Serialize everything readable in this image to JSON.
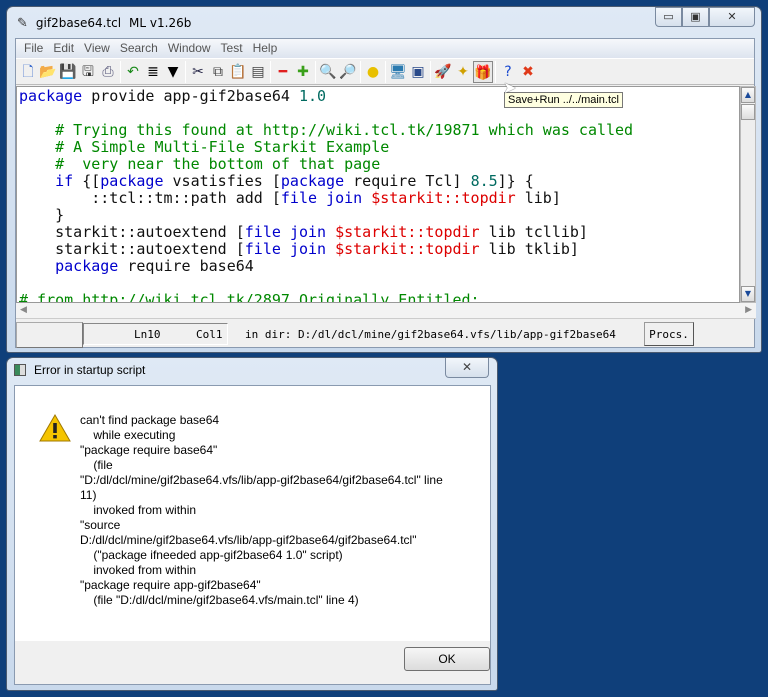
{
  "window": {
    "title": "gif2base64.tcl",
    "version": "ML v1.26b",
    "controls": [
      "minimize",
      "maximize",
      "close"
    ]
  },
  "menu": [
    "File",
    "Edit",
    "View",
    "Search",
    "Window",
    "Test",
    "Help"
  ],
  "toolbar": [
    {
      "icon": "new-file-icon",
      "g": "🗋",
      "c": "#36c"
    },
    {
      "icon": "open-folder-icon",
      "g": "📂",
      "c": "#d9a300"
    },
    {
      "icon": "save-icon",
      "g": "💾",
      "c": "#2244aa"
    },
    {
      "icon": "save-as-icon",
      "g": "🖫",
      "c": "#333"
    },
    {
      "icon": "print-icon",
      "g": "⎙",
      "c": "#557"
    },
    {
      "sep": true
    },
    {
      "icon": "undo-icon",
      "g": "↶",
      "c": "#1a8a1a"
    },
    {
      "icon": "align-icon",
      "g": "≣",
      "c": "#000"
    },
    {
      "icon": "dropdown-icon",
      "g": "▼",
      "c": "#000"
    },
    {
      "sep": true
    },
    {
      "icon": "cut-icon",
      "g": "✂",
      "c": "#224"
    },
    {
      "icon": "copy-icon",
      "g": "⧉",
      "c": "#444"
    },
    {
      "icon": "paste-icon",
      "g": "📋",
      "c": "#865"
    },
    {
      "icon": "paste-special-icon",
      "g": "▤",
      "c": "#444"
    },
    {
      "sep": true
    },
    {
      "icon": "minus-icon",
      "g": "━",
      "c": "#e02020"
    },
    {
      "icon": "plus-icon",
      "g": "✚",
      "c": "#3aa01a"
    },
    {
      "sep": true
    },
    {
      "icon": "find-icon",
      "g": "🔍",
      "c": "#334"
    },
    {
      "icon": "find-replace-icon",
      "g": "🔎",
      "c": "#334"
    },
    {
      "sep": true
    },
    {
      "icon": "search-highlight-icon",
      "g": "●",
      "c": "#e8c000"
    },
    {
      "sep": true
    },
    {
      "icon": "monitor-icon",
      "g": "🖥",
      "c": "#2a7ab0"
    },
    {
      "icon": "window-icon",
      "g": "▣",
      "c": "#2a4a8a"
    },
    {
      "sep": true
    },
    {
      "icon": "rocket-icon",
      "g": "🚀",
      "c": "#d03020"
    },
    {
      "icon": "magic-wand-icon",
      "g": "✦",
      "c": "#d0a000"
    },
    {
      "icon": "save-run-icon",
      "g": "🎁",
      "c": "#c03030"
    },
    {
      "sep": true
    },
    {
      "icon": "help-icon",
      "g": "?",
      "c": "#1a4ad0"
    },
    {
      "icon": "stop-icon",
      "g": "✖",
      "c": "#e03a1a"
    }
  ],
  "tooltip": "Save+Run ../../main.tcl",
  "editor": {
    "lines": [
      [
        [
          "package",
          "kw"
        ],
        [
          " provide app-gif2base64 ",
          "pl"
        ],
        [
          "1.0",
          "nm"
        ]
      ],
      [],
      [
        [
          "    # Trying this found at http://wiki.tcl.tk/19871 which was called",
          "cm"
        ]
      ],
      [
        [
          "    # A Simple Multi-File Starkit Example",
          "cm"
        ]
      ],
      [
        [
          "    #  very near the bottom of that page",
          "cm"
        ]
      ],
      [
        [
          "    ",
          "pl"
        ],
        [
          "if",
          "kw"
        ],
        [
          " {[",
          "pl"
        ],
        [
          "package",
          "kw"
        ],
        [
          " vsatisfies [",
          "pl"
        ],
        [
          "package",
          "kw"
        ],
        [
          " require Tcl] ",
          "pl"
        ],
        [
          "8.5",
          "nm"
        ],
        [
          "]} {",
          "pl"
        ]
      ],
      [
        [
          "        ::tcl::tm::path add [",
          "pl"
        ],
        [
          "file",
          "kw"
        ],
        [
          " ",
          "pl"
        ],
        [
          "join",
          "kw"
        ],
        [
          " ",
          "pl"
        ],
        [
          "$starkit::topdir",
          "vr"
        ],
        [
          " lib]",
          "pl"
        ]
      ],
      [
        [
          "    }",
          "pl"
        ]
      ],
      [
        [
          "    starkit::autoextend [",
          "pl"
        ],
        [
          "file",
          "kw"
        ],
        [
          " ",
          "pl"
        ],
        [
          "join",
          "kw"
        ],
        [
          " ",
          "pl"
        ],
        [
          "$starkit::topdir",
          "vr"
        ],
        [
          " lib tcllib]",
          "pl"
        ]
      ],
      [
        [
          "    starkit::autoextend [",
          "pl"
        ],
        [
          "file",
          "kw"
        ],
        [
          " ",
          "pl"
        ],
        [
          "join",
          "kw"
        ],
        [
          " ",
          "pl"
        ],
        [
          "$starkit::topdir",
          "vr"
        ],
        [
          " lib tklib]",
          "pl"
        ]
      ],
      [
        [
          "    ",
          "pl"
        ],
        [
          "package",
          "kw"
        ],
        [
          " require base64",
          "pl"
        ]
      ],
      [],
      [
        [
          "# from http://wiki.tcl.tk/2897 Originally Entitled:",
          "cm"
        ]
      ]
    ]
  },
  "status": {
    "line": "Ln10",
    "col": "Col1",
    "dir": "in dir: D:/dl/dcl/mine/gif2base64.vfs/lib/app-gif2base64",
    "procs_button": "Procs."
  },
  "dialog": {
    "title": "Error in startup script",
    "icon": "warning-icon",
    "message": "can't find package base64\n    while executing\n\"package require base64\"\n    (file\n\"D:/dl/dcl/mine/gif2base64.vfs/lib/app-gif2base64/gif2base64.tcl\" line\n11)\n    invoked from within\n\"source\nD:/dl/dcl/mine/gif2base64.vfs/lib/app-gif2base64/gif2base64.tcl\"\n    (\"package ifneeded app-gif2base64 1.0\" script)\n    invoked from within\n\"package require app-gif2base64\"\n    (file \"D:/dl/dcl/mine/gif2base64.vfs/main.tcl\" line 4)",
    "ok_button": "OK"
  }
}
